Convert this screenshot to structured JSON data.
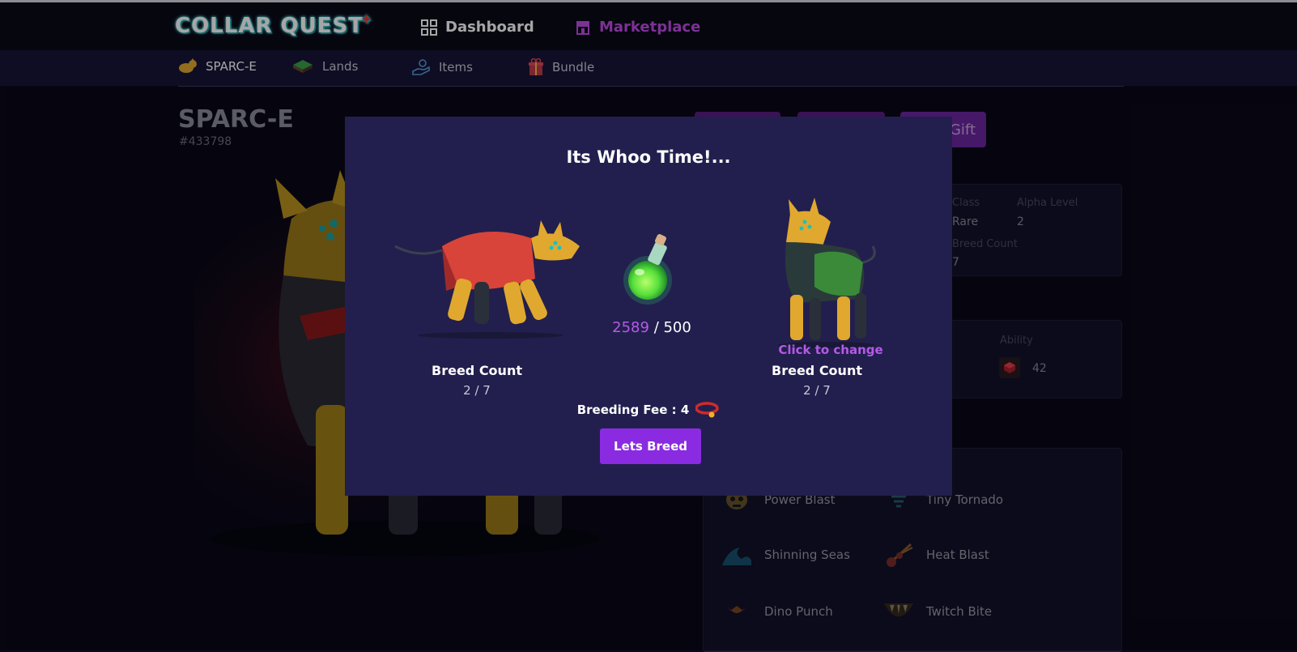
{
  "topbar": {
    "logo": "COLLAR QUEST",
    "nav": [
      {
        "label": "Dashboard",
        "icon": "grid-icon"
      },
      {
        "label": "Marketplace",
        "icon": "store-icon"
      }
    ]
  },
  "subnav": {
    "items": [
      {
        "label": "SPARC-E",
        "icon": "dog-icon"
      },
      {
        "label": "Lands",
        "icon": "land-icon"
      },
      {
        "label": "Items",
        "icon": "hand-item-icon"
      },
      {
        "label": "Bundle",
        "icon": "gift-box-icon"
      }
    ]
  },
  "pet": {
    "name": "SPARC-E",
    "id": "#433798",
    "gift_label": "Gift",
    "class_label": "Class",
    "class_value": "Rare",
    "alpha_label": "Alpha Level",
    "alpha_value": "2",
    "breed_count_label": "Breed Count",
    "breed_count_value": "7",
    "ability_label": "Ability",
    "ability_value": "42"
  },
  "skills": [
    {
      "label": "Power Blast",
      "icon": "skull-icon"
    },
    {
      "label": "Tiny Tornado",
      "icon": "tornado-icon"
    },
    {
      "label": "Shinning Seas",
      "icon": "wave-icon"
    },
    {
      "label": "Heat Blast",
      "icon": "fireball-icon"
    },
    {
      "label": "Dino Punch",
      "icon": "claw-icon"
    },
    {
      "label": "Twitch Bite",
      "icon": "jaw-icon"
    }
  ],
  "modal": {
    "title": "Its Whoo Time!...",
    "potion_have": "2589",
    "potion_sep": " / ",
    "potion_need": "500",
    "left": {
      "breed_label": "Breed Count",
      "breed_value": "2 / 7"
    },
    "right": {
      "change_label": "Click to change",
      "breed_label": "Breed Count",
      "breed_value": "2 / 7"
    },
    "fee_label": "Breeding Fee : 4",
    "fee_icon": "collar-icon",
    "button_label": "Lets Breed"
  },
  "colors": {
    "accent": "#8a2be2",
    "accent_text": "#b45ae6",
    "modal_bg": "#221f4e",
    "page_bg": "#0b0a1a"
  }
}
